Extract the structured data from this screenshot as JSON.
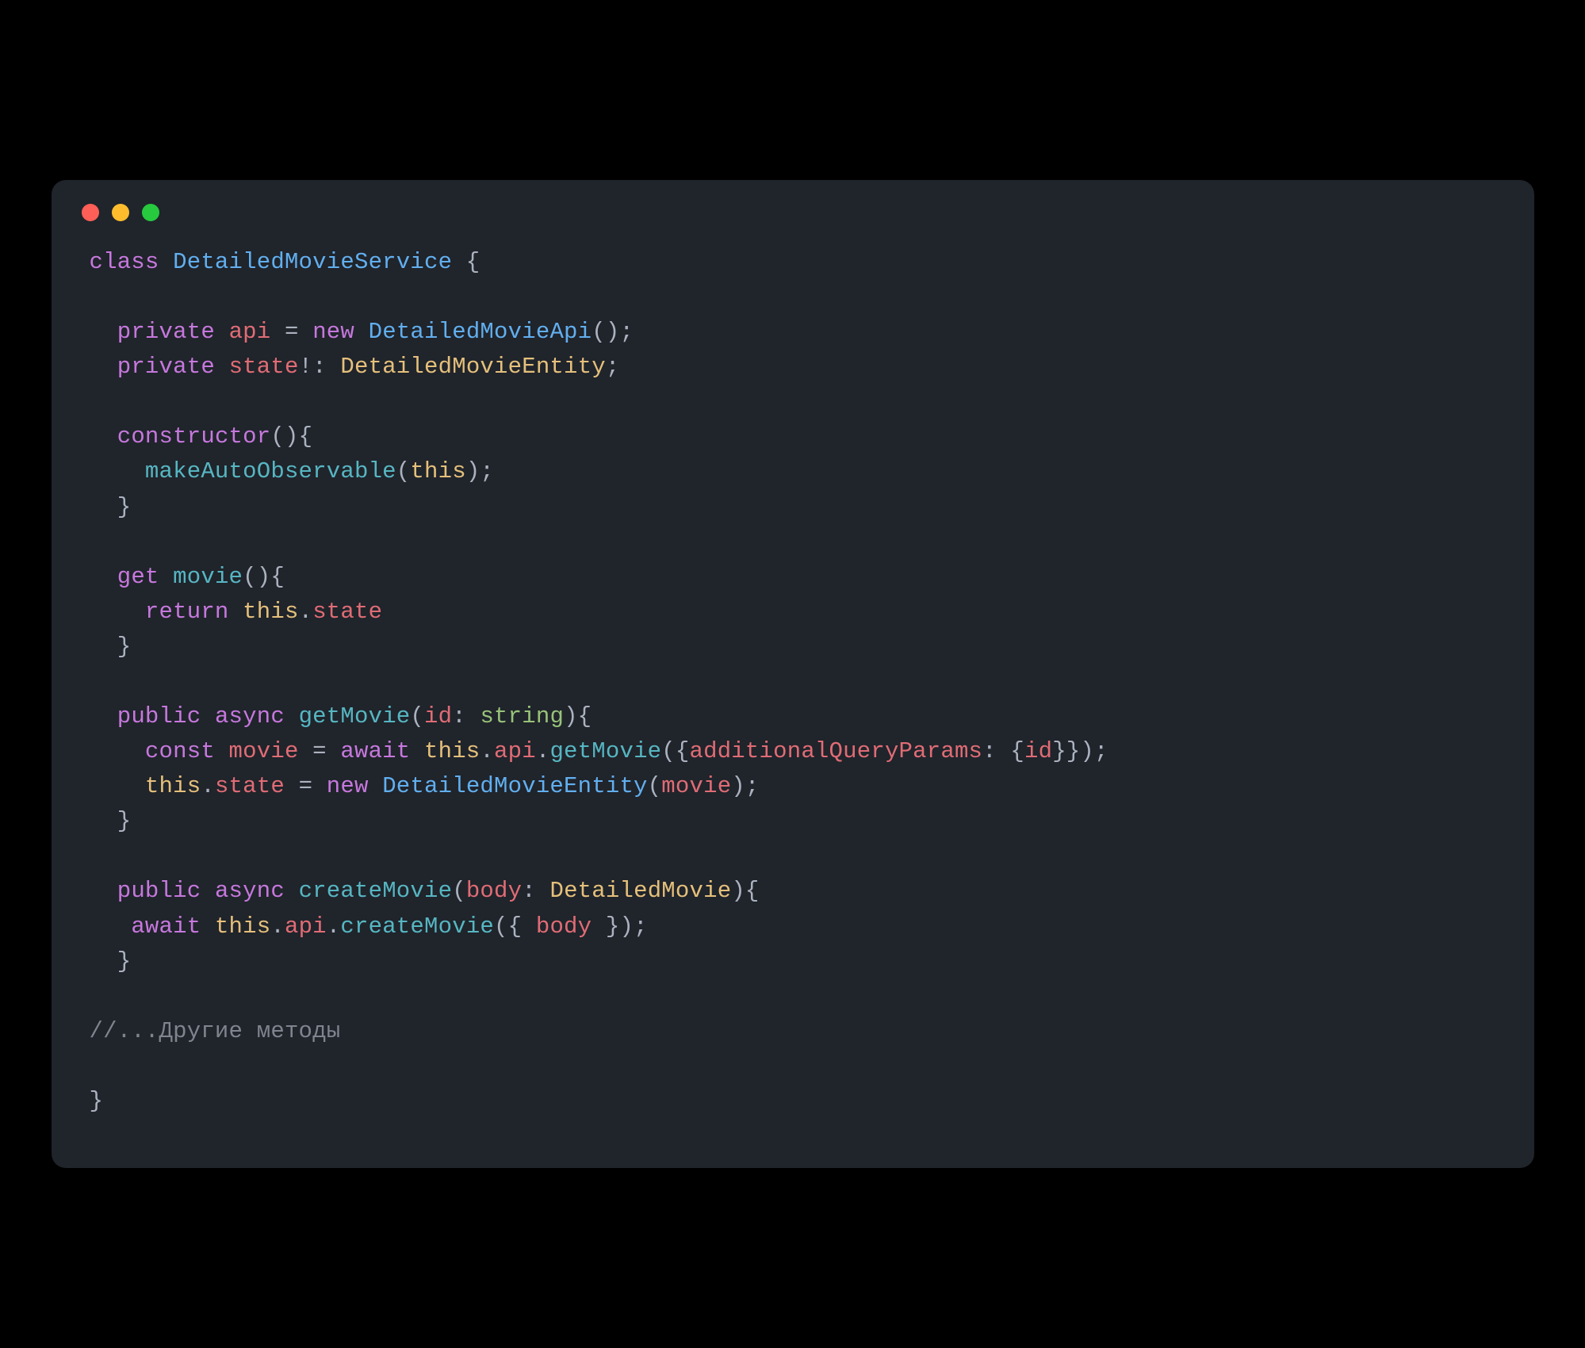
{
  "titlebar": {
    "close": "close",
    "minimize": "minimize",
    "zoom": "zoom"
  },
  "code": {
    "l01_class": "class",
    "l01_name": "DetailedMovieService",
    "l01_brace": " {",
    "l03_priv": "private",
    "l03_api": "api",
    "l03_eq": " = ",
    "l03_new": "new",
    "l03_ctor": "DetailedMovieApi",
    "l03_end": "();",
    "l04_priv": "private",
    "l04_state": "state",
    "l04_bang": "!: ",
    "l04_type": "DetailedMovieEntity",
    "l04_end": ";",
    "l06_ctor": "constructor",
    "l06_sig": "(){",
    "l07_fn": "makeAutoObservable",
    "l07_open": "(",
    "l07_this": "this",
    "l07_end": ");",
    "l08_close": "}",
    "l10_get": "get",
    "l10_name": "movie",
    "l10_sig": "(){",
    "l11_ret": "return",
    "l11_this": "this",
    "l11_dot": ".",
    "l11_state": "state",
    "l12_close": "}",
    "l14_pub": "public",
    "l14_async": "async",
    "l14_name": "getMovie",
    "l14_open": "(",
    "l14_param": "id",
    "l14_colon": ": ",
    "l14_type": "string",
    "l14_end": "){",
    "l15_const": "const",
    "l15_var": "movie",
    "l15_eq": " = ",
    "l15_await": "await",
    "l15_this": "this",
    "l15_dot1": ".",
    "l15_api": "api",
    "l15_dot2": ".",
    "l15_fn": "getMovie",
    "l15_open": "({",
    "l15_k": "additionalQueryParams",
    "l15_mid": ": {",
    "l15_id": "id",
    "l15_end": "}});",
    "l16_this": "this",
    "l16_dot": ".",
    "l16_state": "state",
    "l16_eq": " = ",
    "l16_new": "new",
    "l16_type": "DetailedMovieEntity",
    "l16_open": "(",
    "l16_arg": "movie",
    "l16_end": ");",
    "l17_close": "}",
    "l19_pub": "public",
    "l19_async": "async",
    "l19_name": "createMovie",
    "l19_open": "(",
    "l19_param": "body",
    "l19_colon": ": ",
    "l19_type": "DetailedMovie",
    "l19_end": "){",
    "l20_await": "await",
    "l20_this": "this",
    "l20_dot1": ".",
    "l20_api": "api",
    "l20_dot2": ".",
    "l20_fn": "createMovie",
    "l20_open": "({ ",
    "l20_arg": "body",
    "l20_end": " });",
    "l21_close": "}",
    "l23_cmt": "//...Другие методы",
    "l25_close": "}"
  }
}
